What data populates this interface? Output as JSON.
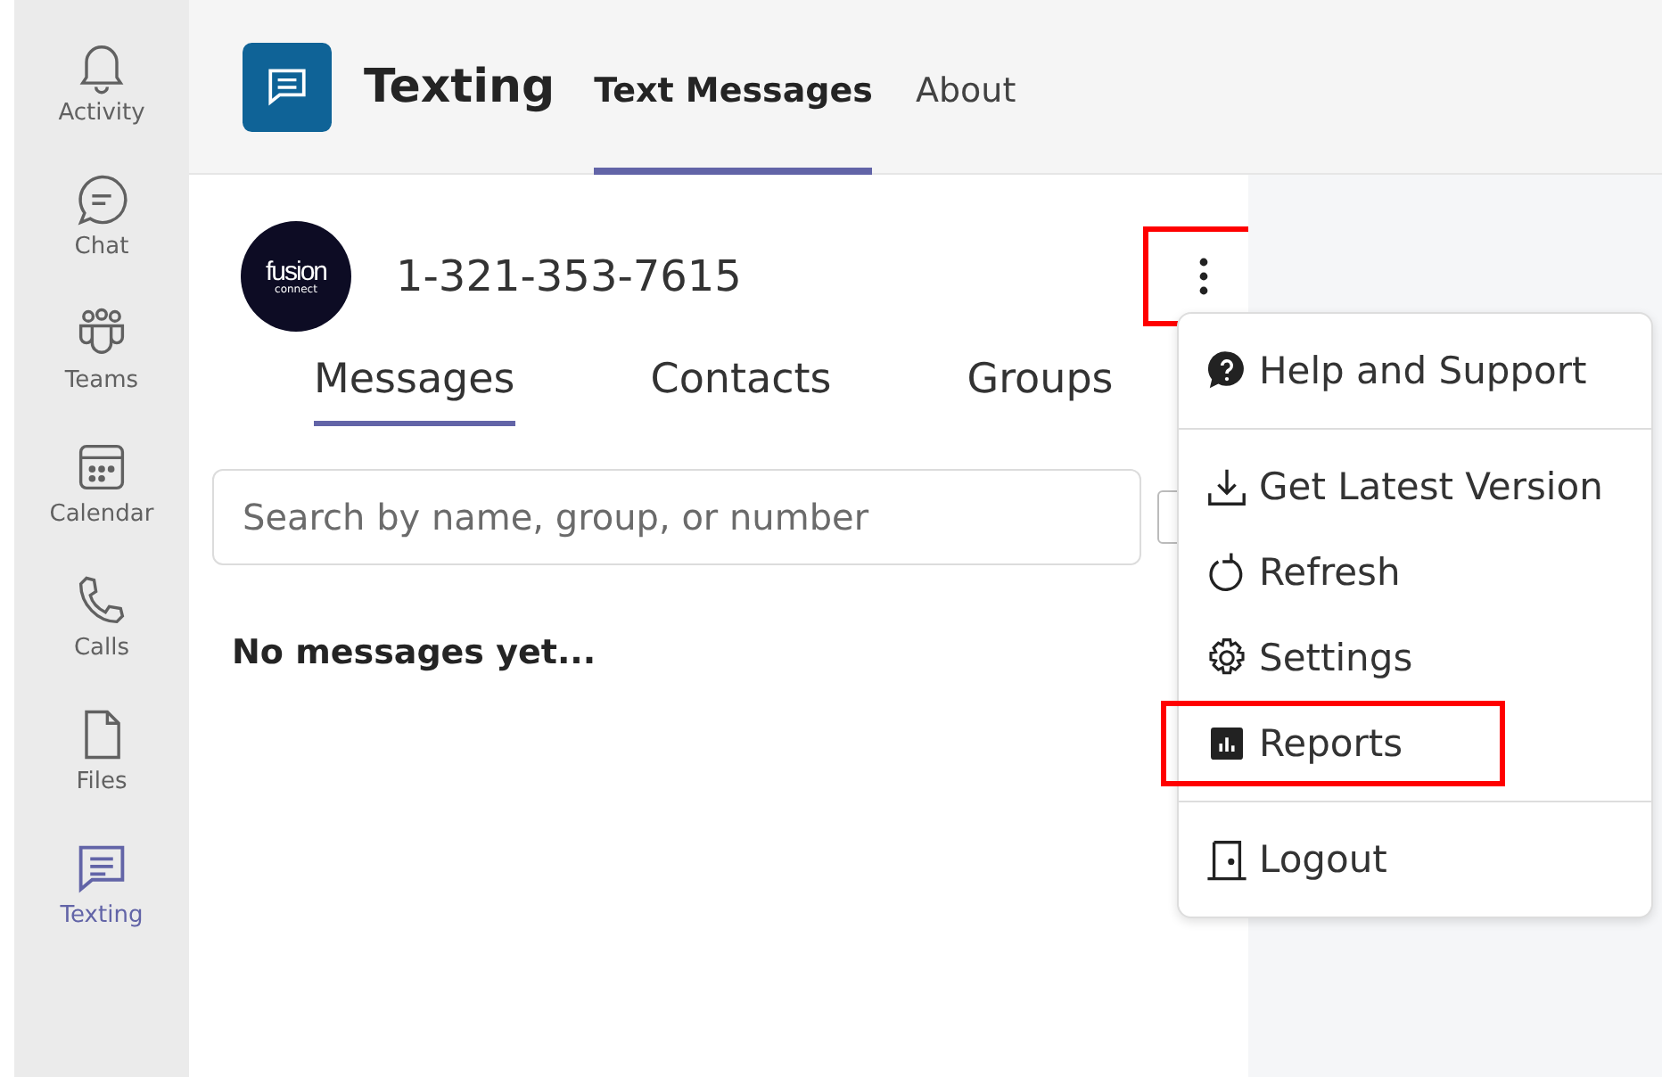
{
  "sidebar": {
    "items": [
      {
        "label": "Activity",
        "kind": "bell",
        "selected": false
      },
      {
        "label": "Chat",
        "kind": "chat",
        "selected": false
      },
      {
        "label": "Teams",
        "kind": "teams",
        "selected": false
      },
      {
        "label": "Calendar",
        "kind": "calendar",
        "selected": false
      },
      {
        "label": "Calls",
        "kind": "phone",
        "selected": false
      },
      {
        "label": "Files",
        "kind": "file",
        "selected": false
      },
      {
        "label": "Texting",
        "kind": "texting",
        "selected": true
      }
    ]
  },
  "header": {
    "app_name": "Texting",
    "tabs": [
      {
        "label": "Text Messages",
        "selected": true
      },
      {
        "label": "About",
        "selected": false
      }
    ]
  },
  "account": {
    "logo": {
      "word": "fusion",
      "sub": "connect"
    },
    "phone": "1-321-353-7615",
    "menu_button": {
      "highlighted": true
    }
  },
  "subtabs": [
    {
      "label": "Messages",
      "selected": true
    },
    {
      "label": "Contacts",
      "selected": false
    },
    {
      "label": "Groups",
      "selected": false
    }
  ],
  "search": {
    "placeholder": "Search by name, group, or number"
  },
  "empty_message": "No messages yet...",
  "menu": {
    "sections": [
      [
        {
          "label": "Help and Support",
          "kind": "help",
          "highlighted": false
        }
      ],
      [
        {
          "label": "Get Latest Version",
          "kind": "download",
          "highlighted": false
        },
        {
          "label": "Refresh",
          "kind": "refresh",
          "highlighted": false
        },
        {
          "label": "Settings",
          "kind": "gear",
          "highlighted": false
        },
        {
          "label": "Reports",
          "kind": "chart",
          "highlighted": true
        }
      ],
      [
        {
          "label": "Logout",
          "kind": "door",
          "highlighted": false
        }
      ]
    ]
  }
}
